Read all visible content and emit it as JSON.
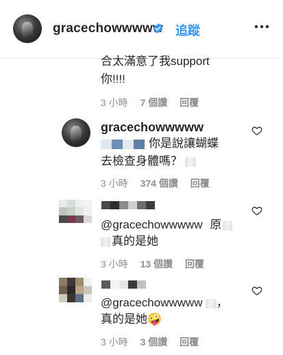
{
  "header": {
    "username": "gracechowwwww",
    "follow_label": "追蹤",
    "more_icon": "more-options-icon",
    "verified_icon": "verified-badge-icon"
  },
  "comments": [
    {
      "text_line1": "合太滿意了我support",
      "text_line2": "你!!!!",
      "time": "3 小時",
      "likes": "7 個讚",
      "reply": "回覆"
    },
    {
      "username": "gracechowwwww",
      "text_line1": "你是說讓蝴蝶",
      "text_line2": "去檢查身體嗎？",
      "time": "3 小時",
      "likes": "374 個讚",
      "reply": "回覆"
    },
    {
      "mention": "@gracechowwwww",
      "text_tail": "原",
      "text_line2": "真的是她",
      "time": "3 小時",
      "likes": "13 個讚",
      "reply": "回覆"
    },
    {
      "mention": "@gracechowwwww",
      "text_tail": "，",
      "text_line2": "真的是她🤪",
      "time": "3 小時",
      "likes": "3 個讚",
      "reply": "回覆"
    }
  ]
}
